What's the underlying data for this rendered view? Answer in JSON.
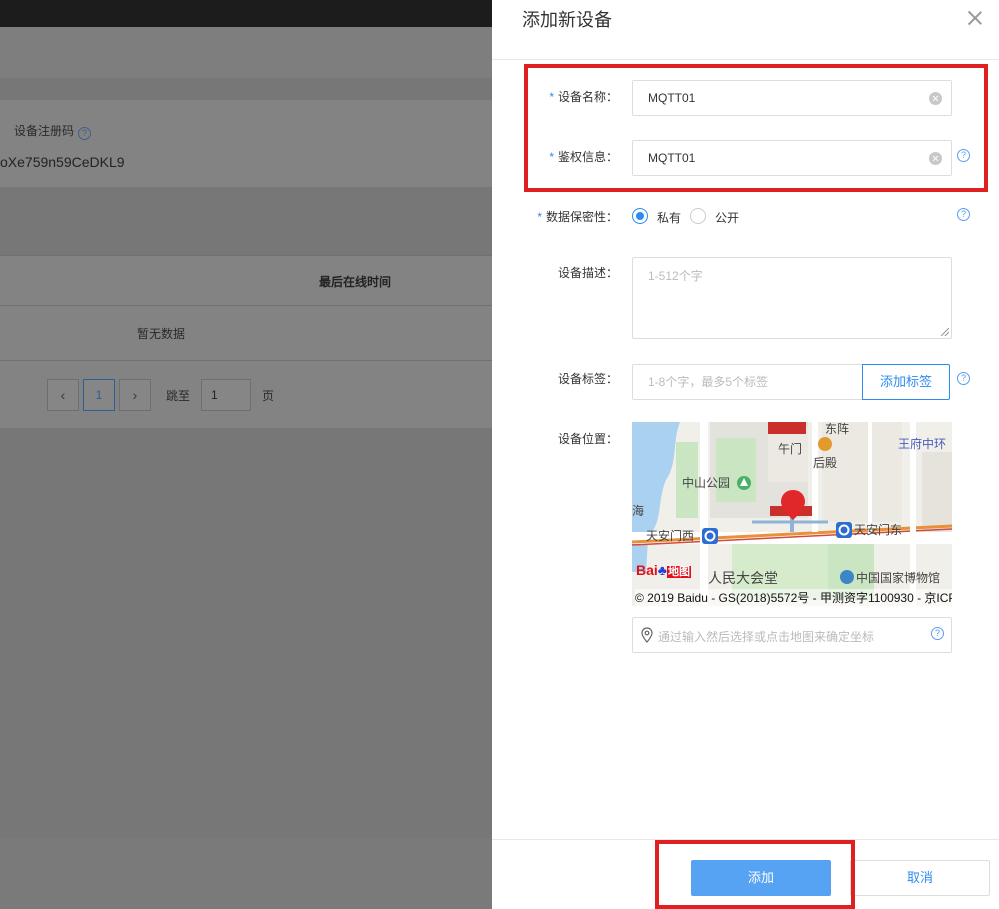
{
  "background_page": {
    "registration_code_label": "设备注册码",
    "registration_code_value": "oXe759n59CeDKL9",
    "table_header_last_online": "最后在线时间",
    "table_empty_text": "暂无数据",
    "pager": {
      "prev": "‹",
      "current_page": "1",
      "next": "›",
      "jump_label": "跳至",
      "jump_value": "1",
      "page_suffix": "页"
    },
    "help_glyph": "?"
  },
  "drawer": {
    "title": "添加新设备",
    "required_mark": "*",
    "fields": {
      "device_name": {
        "label": "设备名称：",
        "value": "MQTT01"
      },
      "auth_info": {
        "label": "鉴权信息：",
        "value": "MQTT01"
      },
      "privacy": {
        "label": "数据保密性：",
        "options": [
          "私有",
          "公开"
        ],
        "selected": "私有"
      },
      "description": {
        "label": "设备描述：",
        "placeholder": "1-512个字"
      },
      "tags": {
        "label": "设备标签：",
        "placeholder": "1-8个字，最多5个标签",
        "add_button": "添加标签"
      },
      "location": {
        "label": "设备位置：",
        "coordinate_placeholder": "通过输入然后选择或点击地图来确定坐标"
      }
    },
    "map": {
      "labels": {
        "dongpan": "东阵",
        "wumen": "午门",
        "houdian": "后殿",
        "wangfuzhonghuan": "王府中环",
        "zhongshan_park": "中山公园",
        "hai": "海",
        "tiananmen_west": "天安门西",
        "tiananmen_east": "天安门东",
        "great_hall": "人民大会堂",
        "national_museum": "中国国家博物馆"
      },
      "logo_text": "Bai",
      "logo_ditu": "地图",
      "copyright": "© 2019 Baidu - GS(2018)5572号 - 甲测资字1100930 - 京ICP"
    },
    "footer": {
      "submit_label": "添加",
      "cancel_label": "取消"
    },
    "help_glyph": "?"
  },
  "colors": {
    "accent": "#2d8cf0",
    "primary_button": "#57a3f3",
    "highlight": "#e02020",
    "overlay": "#7e7e7e"
  },
  "icons": [
    "close-icon",
    "clear-icon",
    "help-icon",
    "map-pin-icon",
    "location-pin-icon",
    "metro-icon",
    "tree-icon",
    "poi-icon"
  ]
}
